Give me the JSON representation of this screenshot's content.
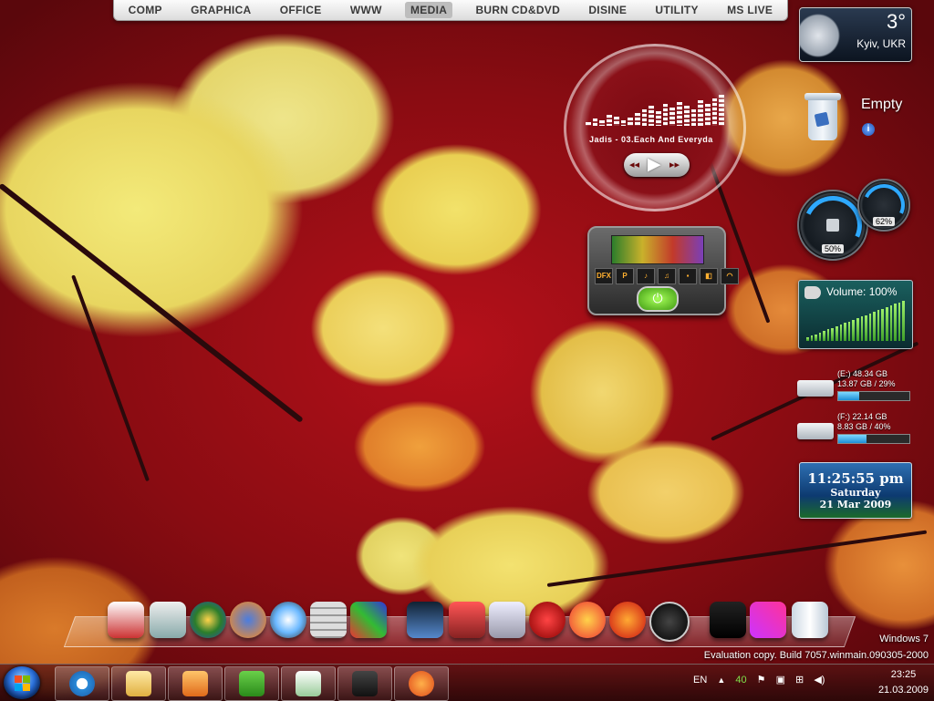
{
  "menu": [
    "COMP",
    "GRAPHICA",
    "OFFICE",
    "WWW",
    "MEDIA",
    "BURN CD&DVD",
    "DISINE",
    "UTILITY",
    "MS LIVE"
  ],
  "menu_active": "MEDIA",
  "weather": {
    "temp": "3°",
    "city": "Kyiv, UKR"
  },
  "recycle": {
    "label": "Empty",
    "info": "i"
  },
  "gauges": {
    "cpu_pct": "50%",
    "ram_pct": "62%",
    "cpu_value": 50,
    "ram_value": 62
  },
  "volume": {
    "label": "Volume: 100%",
    "level": 100
  },
  "drives": [
    {
      "line1": "(E:) 48.34 GB",
      "line2": "13.87 GB / 29%",
      "used": 29
    },
    {
      "line1": "(F:) 22.14 GB",
      "line2": "8.83 GB / 40%",
      "used": 40
    }
  ],
  "clock": {
    "time": "11:25:55 pm",
    "day": "Saturday",
    "date": "21 Mar 2009"
  },
  "player": {
    "song": "Jadis - 03.Each And Everyda",
    "prev": "◂◂",
    "play": "▶",
    "next": "▸▸"
  },
  "dfx": {
    "buttons": [
      "DFX",
      "P",
      "♪",
      "♫",
      "▪",
      "◧",
      "◠"
    ],
    "power": "⏻"
  },
  "watermark": {
    "os": "Windows 7",
    "build": "Evaluation copy. Build 7057.winmain.090305-2000"
  },
  "taskbar": {
    "apps": [
      "internet-explorer",
      "windows-explorer",
      "media-player",
      "utorrent",
      "qip",
      "dfx",
      "wimp-8"
    ]
  },
  "tray": {
    "lang": "EN",
    "arrow": "▲",
    "num": "40",
    "time": "23:25",
    "date": "21.03.2009"
  },
  "colors": {
    "accent": "#2ea9ff",
    "volume_green": "#7fe04a"
  }
}
